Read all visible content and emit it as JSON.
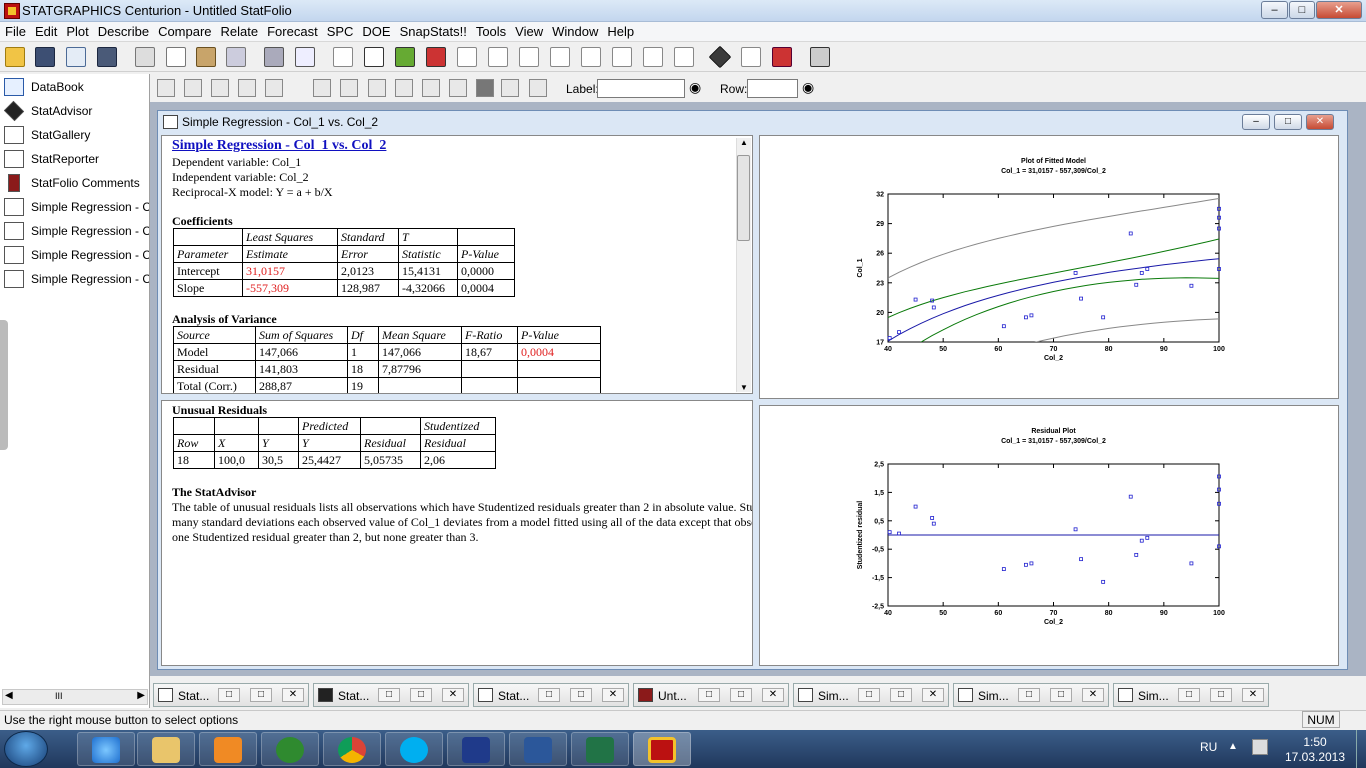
{
  "app": {
    "title": "STATGRAPHICS Centurion - Untitled StatFolio"
  },
  "window_controls": {
    "minimize": "–",
    "maximize": "□",
    "close": "✕"
  },
  "menu": [
    "File",
    "Edit",
    "Plot",
    "Describe",
    "Compare",
    "Relate",
    "Forecast",
    "SPC",
    "DOE",
    "SnapStats!!",
    "Tools",
    "View",
    "Window",
    "Help"
  ],
  "toolbar2": {
    "label_label": "Label:",
    "row_label": "Row:"
  },
  "sidebar": {
    "items": [
      {
        "label": "DataBook",
        "icon": "databook-icon"
      },
      {
        "label": "StatAdvisor",
        "icon": "statadvisor-icon"
      },
      {
        "label": "StatGallery",
        "icon": "statgallery-icon"
      },
      {
        "label": "StatReporter",
        "icon": "statreporter-icon"
      },
      {
        "label": "StatFolio Comments",
        "icon": "comments-icon"
      },
      {
        "label": "Simple Regression - Col_",
        "icon": "analysis-icon"
      },
      {
        "label": "Simple Regression - Col_",
        "icon": "analysis-icon"
      },
      {
        "label": "Simple Regression - Col_",
        "icon": "analysis-icon"
      },
      {
        "label": "Simple Regression - Col_",
        "icon": "analysis-icon"
      }
    ],
    "scroll_mid": "III"
  },
  "doc": {
    "title": "Simple Regression - Col_1 vs. Col_2"
  },
  "summary": {
    "heading": "Simple Regression - Col_1 vs. Col_2",
    "dep": "Dependent variable: Col_1",
    "indep": "Independent variable: Col_2",
    "model": "Reciprocal-X model: Y = a + b/X",
    "coef_heading": "Coefficients",
    "coef_head1": [
      "",
      "Least Squares",
      "Standard",
      "T",
      ""
    ],
    "coef_head2": [
      "Parameter",
      "Estimate",
      "Error",
      "Statistic",
      "P-Value"
    ],
    "coef_rows": [
      [
        "Intercept",
        "31,0157",
        "2,0123",
        "15,4131",
        "0,0000"
      ],
      [
        "Slope",
        "-557,309",
        "128,987",
        "-4,32066",
        "0,0004"
      ]
    ],
    "anova_heading": "Analysis of Variance",
    "anova_head": [
      "Source",
      "Sum of Squares",
      "Df",
      "Mean Square",
      "F-Ratio",
      "P-Value"
    ],
    "anova_rows": [
      [
        "Model",
        "147,066",
        "1",
        "147,066",
        "18,67",
        "0,0004"
      ],
      [
        "Residual",
        "141,803",
        "18",
        "7,87796",
        "",
        ""
      ],
      [
        "Total (Corr.)",
        "288,87",
        "19",
        "",
        "",
        ""
      ]
    ]
  },
  "unusual": {
    "heading": "Unusual Residuals",
    "head1": [
      "",
      "",
      "",
      "Predicted",
      "",
      "Studentized"
    ],
    "head2": [
      "Row",
      "X",
      "Y",
      "Y",
      "Residual",
      "Residual"
    ],
    "rows": [
      [
        "18",
        "100,0",
        "30,5",
        "25,4427",
        "5,05735",
        "2,06"
      ]
    ],
    "advisor_heading": "The StatAdvisor",
    "advisor_lines": [
      "The table of unusual residuals lists all observations which have Studentized residuals greater than 2 in absolute value.  Stu",
      "many standard deviations each observed value of Col_1 deviates from a model fitted using all of the data except that obse",
      "one Studentized residual greater than 2, but none greater than 3."
    ]
  },
  "colors": {
    "fit": "#1a1aa8",
    "confidence": "#0a7a0a",
    "prediction": "#888888",
    "points": "#1f1fcf",
    "red_value": "#e02020"
  },
  "chart_data": [
    {
      "type": "scatter",
      "title": "Plot of Fitted Model",
      "subtitle": "Col_1 = 31,0157 - 557,309/Col_2",
      "xlabel": "Col_2",
      "ylabel": "Col_1",
      "xlim": [
        40,
        100
      ],
      "ylim": [
        17,
        32
      ],
      "xticks": [
        "40",
        "50",
        "60",
        "70",
        "80",
        "90",
        "100"
      ],
      "yticks": [
        "17",
        "20",
        "23",
        "26",
        "29",
        "32"
      ],
      "x": [
        40.3,
        42.0,
        45.0,
        48.0,
        48.3,
        61.0,
        65.0,
        66.0,
        74.0,
        75.0,
        79.0,
        84.0,
        85.0,
        86.0,
        87.0,
        95.0,
        100.0,
        100.0,
        100.0,
        100.0
      ],
      "y": [
        17.4,
        18.0,
        21.3,
        21.2,
        20.5,
        18.6,
        19.5,
        19.7,
        24.0,
        21.4,
        19.5,
        28.0,
        22.8,
        24.0,
        24.4,
        22.7,
        30.5,
        29.6,
        28.5,
        24.4
      ],
      "fit": {
        "a": 31.0157,
        "b": -557.309
      },
      "confidence_halfwidth": [
        2.4,
        1.0,
        2.0
      ],
      "prediction_halfwidth": [
        6.4,
        5.7,
        6.1
      ]
    },
    {
      "type": "scatter",
      "title": "Residual Plot",
      "subtitle": "Col_1 = 31,0157 - 557,309/Col_2",
      "xlabel": "Col_2",
      "ylabel": "Studentized residual",
      "xlim": [
        40,
        100
      ],
      "ylim": [
        -2.5,
        2.5
      ],
      "xticks": [
        "40",
        "50",
        "60",
        "70",
        "80",
        "90",
        "100"
      ],
      "yticks": [
        "-2,5",
        "-1,5",
        "-0,5",
        "0,5",
        "1,5",
        "2,5"
      ],
      "x": [
        40.3,
        42.0,
        45.0,
        48.0,
        48.3,
        61.0,
        65.0,
        66.0,
        74.0,
        75.0,
        79.0,
        84.0,
        85.0,
        86.0,
        87.0,
        95.0,
        100.0,
        100.0,
        100.0,
        100.0
      ],
      "y": [
        0.1,
        0.05,
        1.0,
        0.6,
        0.4,
        -1.2,
        -1.05,
        -1.0,
        0.2,
        -0.85,
        -1.65,
        1.35,
        -0.7,
        -0.2,
        -0.1,
        -1.0,
        2.06,
        1.6,
        1.1,
        -0.4
      ]
    }
  ],
  "mdi_tabs": [
    "Stat...",
    "Stat...",
    "Stat...",
    "Unt...",
    "Sim...",
    "Sim...",
    "Sim..."
  ],
  "status": {
    "text": "Use the right mouse button to select options",
    "num": "NUM"
  },
  "tray": {
    "lang": "RU",
    "time": "1:50",
    "date": "17.03.2013"
  }
}
